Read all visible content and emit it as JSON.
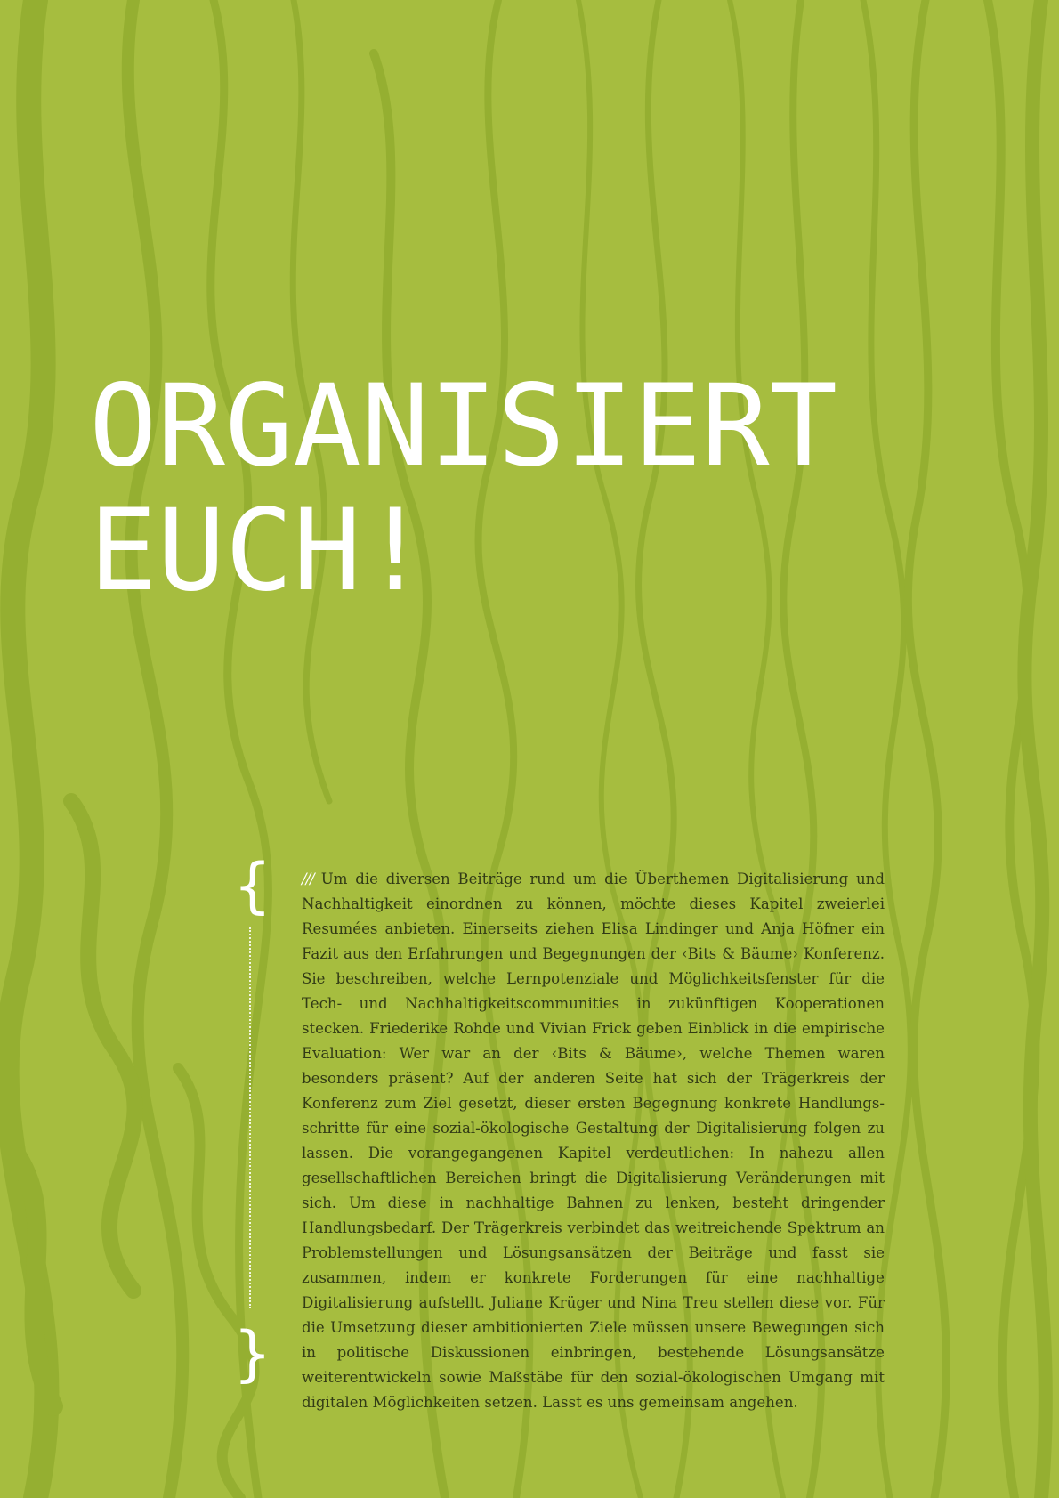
{
  "title": {
    "line1": "ORGANISIERT",
    "line2": "EUCH!"
  },
  "intro": {
    "marker": "///",
    "text": "Um die diversen Beiträge rund um die Überthemen Digitalisierung und Nachhaltigkeit einordnen zu können, möchte dieses Kapitel zweierlei Resumées an­bieten. Einerseits ziehen Elisa Lindinger und Anja Höfner ein Fazit aus den Erfahrun­gen und Begegnungen der ‹Bits & Bäume› Konferenz. Sie beschreiben, welche Lern­potenziale und Möglichkeitsfenster für die Tech- und Nachhaltigkeitscommunities in zukünftigen Kooperationen stecken. Friederike Rohde und Vivian Frick geben Einblick in die empirische Evaluation: Wer war an der ‹Bits & Bäume›, welche Themen waren besonders präsent? Auf der anderen Seite hat sich der Trägerkreis der Konferenz zum Ziel gesetzt, dieser ersten Begegnung konkrete Handlungs­schritte für eine sozial-ökologische Gestaltung der Digitalisierung folgen zu lassen. Die vorangegangenen Kapitel verdeutlichen: In nahezu allen gesellschaftlichen Bereichen bringt die Digitalisierung Veränderungen mit sich. Um diese in nachhal­tige Bahnen zu lenken, besteht dringender Handlungsbedarf. Der Trägerkreis ver­bindet das weitreichende Spektrum an Problemstellungen und Lösungsansätzen der Beiträge und fasst sie zusammen, indem er konkrete Forderungen für eine nach­haltige Digitalisierung aufstellt. Juliane Krüger und Nina Treu stellen diese vor. Für die Umsetzung dieser ambitionierten Ziele müssen unsere Bewegungen sich in politische Diskussionen einbringen, bestehende Lösungsansätze weiterentwickeln sowie Maßstäbe für den sozial-ökologischen Umgang mit digitalen Möglichkeiten setzen. Lasst es uns gemeinsam angehen."
  },
  "decor": {
    "brace_open": "{",
    "brace_close": "}"
  },
  "colors": {
    "background": "#a6bd3f",
    "texture": "#94ae30",
    "title": "#ffffff",
    "body_text": "#323b16"
  }
}
